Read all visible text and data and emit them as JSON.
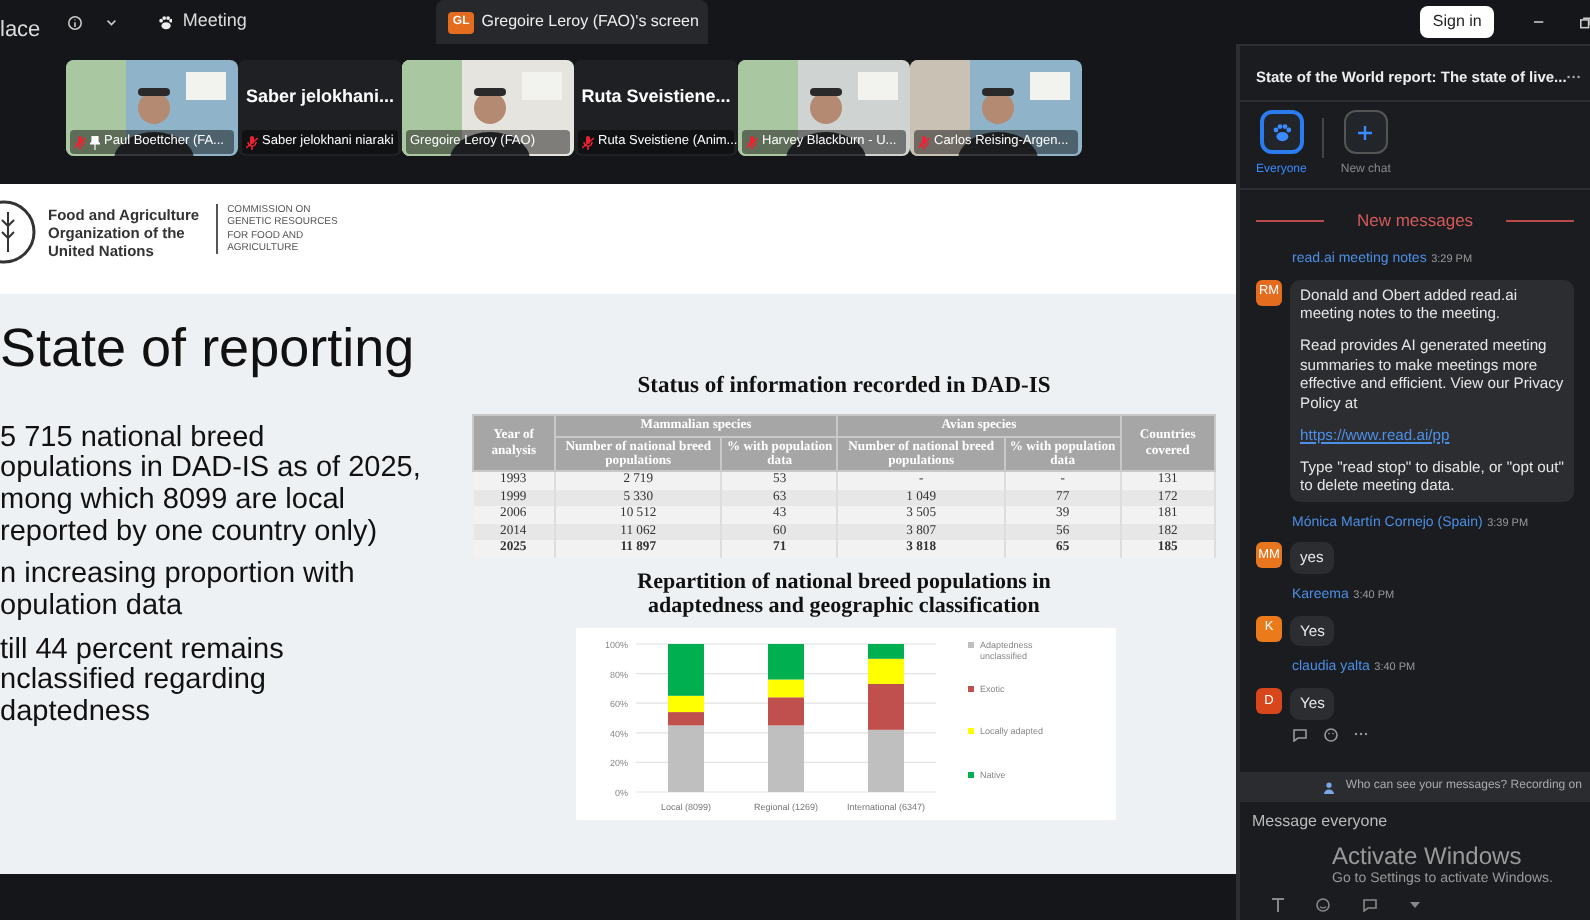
{
  "top_bar": {
    "cut_title": "lace",
    "meeting_label": "Meeting",
    "share_tab": {
      "initials": "GL",
      "label": "Gregoire Leroy (FAO)'s screen"
    },
    "sign_in": "Sign in"
  },
  "participants": [
    {
      "kind": "video",
      "label": "Paul Boettcher (FA...",
      "muted": true,
      "pinned": true,
      "active": false
    },
    {
      "kind": "name",
      "display": "Saber  jelokhani...",
      "label": "Saber jelokhani niaraki",
      "muted": true,
      "pinned": false,
      "active": false
    },
    {
      "kind": "video",
      "label": "Gregoire Leroy (FAO)",
      "muted": false,
      "pinned": false,
      "active": true
    },
    {
      "kind": "name",
      "display": "Ruta  Sveistiene...",
      "label": "Ruta Sveistiene (Anim...",
      "muted": true,
      "pinned": false,
      "active": false
    },
    {
      "kind": "video",
      "label": "Harvey Blackburn - U...",
      "muted": true,
      "pinned": false,
      "active": false
    },
    {
      "kind": "video",
      "label": "Carlos Reising-Argen...",
      "muted": true,
      "pinned": false,
      "active": false
    }
  ],
  "slide": {
    "org_lines": [
      "Food and Agriculture",
      "Organization of the",
      "United Nations"
    ],
    "commission_lines": [
      "COMMISSION ON",
      "GENETIC RESOURCES",
      "FOR FOOD AND",
      "AGRICULTURE"
    ],
    "title": "State of reporting",
    "bullets": [
      [
        "5 715 national breed",
        "opulations in DAD-IS as of 2025,",
        "mong which 8099 are local",
        "reported by one country only)"
      ],
      [
        "n increasing proportion with",
        "opulation data"
      ],
      [
        "till 44 percent remains",
        "nclassified regarding",
        "daptedness"
      ]
    ],
    "table": {
      "title": "Status of information recorded in DAD-IS",
      "first_column": "Year of analysis",
      "groups": [
        "Mammalian species",
        "Avian species"
      ],
      "subcolumns": [
        "Number of national breed populations",
        "% with population data",
        "Number of national breed populations",
        "% with population data"
      ],
      "last_column": "Countries covered",
      "rows": [
        {
          "bold": false,
          "cells": [
            "1993",
            "2 719",
            "53",
            "-",
            "-",
            "131"
          ]
        },
        {
          "bold": false,
          "cells": [
            "1999",
            "5 330",
            "63",
            "1 049",
            "77",
            "172"
          ]
        },
        {
          "bold": false,
          "cells": [
            "2006",
            "10 512",
            "43",
            "3 505",
            "39",
            "181"
          ]
        },
        {
          "bold": false,
          "cells": [
            "2014",
            "11 062",
            "60",
            "3 807",
            "56",
            "182"
          ]
        },
        {
          "bold": true,
          "cells": [
            "2025",
            "11 897",
            "71",
            "3 818",
            "65",
            "185"
          ]
        }
      ]
    },
    "chart_title": "Repartition of national breed populations in adaptedness and geographic classification",
    "chart_data": {
      "type": "bar",
      "stacked": true,
      "categories": [
        "Local (8099)",
        "Regional (1269)",
        "International (6347)"
      ],
      "series": [
        {
          "name": "Adaptedness unclassified",
          "color": "#bfbfbf",
          "values": [
            45,
            45,
            42
          ]
        },
        {
          "name": "Exotic",
          "color": "#c0504d",
          "values": [
            9,
            19,
            31
          ]
        },
        {
          "name": "Locally adapted",
          "color": "#ffff00",
          "values": [
            11,
            12,
            17
          ]
        },
        {
          "name": "Native",
          "color": "#00b050",
          "values": [
            35,
            24,
            10
          ]
        }
      ],
      "grid": true,
      "legend": true,
      "ylim": [
        0,
        100
      ],
      "yticks": [
        {
          "value": 0,
          "label": "0%"
        },
        {
          "value": 20,
          "label": "20%"
        },
        {
          "value": 40,
          "label": "40%"
        },
        {
          "value": 60,
          "label": "60%"
        },
        {
          "value": 80,
          "label": "80%"
        },
        {
          "value": 100,
          "label": "100%"
        }
      ]
    }
  },
  "chat": {
    "title": "State of the World report: The state of live...",
    "more": "···",
    "tabs": [
      {
        "label": "Everyone",
        "selected": true,
        "kind": "group"
      },
      {
        "label": "New chat",
        "selected": false,
        "kind": "add"
      }
    ],
    "divider": "New messages",
    "messages": [
      {
        "sender": "read.ai meeting notes",
        "time": "3:29 PM",
        "initials": "RM",
        "color": "#e36c1f",
        "parts": [
          {
            "kind": "text",
            "text": "Donald and Obert added read.ai meeting notes to the meeting."
          },
          {
            "kind": "text",
            "text": "Read provides AI generated meeting summaries to make meetings more effective and efficient. View our Privacy Policy at"
          },
          {
            "kind": "link",
            "text": "https://www.read.ai/pp"
          },
          {
            "kind": "text",
            "text": "Type \"read stop\" to disable, or \"opt out\" to delete meeting data."
          }
        ]
      },
      {
        "sender": "Mónica Martín Cornejo (Spain)",
        "time": "3:39 PM",
        "initials": "MM",
        "color": "#e8761e",
        "parts": [
          {
            "kind": "text",
            "text": "yes"
          }
        ]
      },
      {
        "sender": "Kareema",
        "time": "3:40 PM",
        "initials": "K",
        "color": "#ea7a1a",
        "parts": [
          {
            "kind": "text",
            "text": "Yes"
          }
        ]
      },
      {
        "sender": "claudia yalta",
        "time": "3:40 PM",
        "initials": "D",
        "color": "#d8471c",
        "parts": [
          {
            "kind": "text",
            "text": "Yes"
          }
        ]
      }
    ],
    "privacy_note": "Who can see your messages? Recording on",
    "input": {
      "placeholder": "Message everyone"
    },
    "activation": {
      "title": "Activate Windows",
      "subtitle": "Go to Settings to activate Windows."
    }
  }
}
